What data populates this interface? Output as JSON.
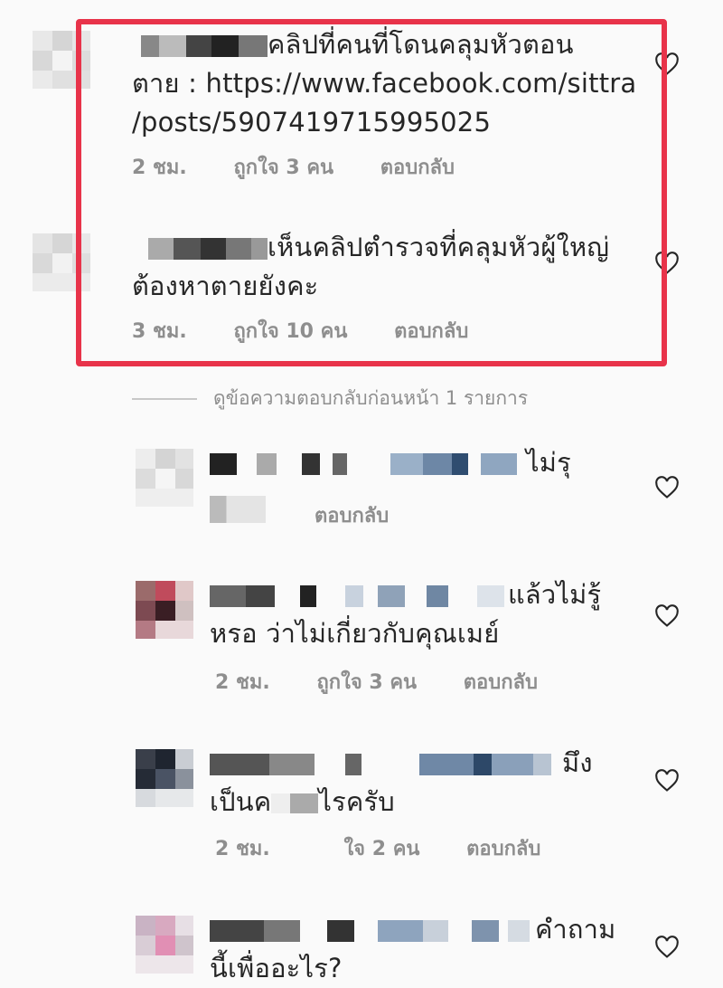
{
  "comments": [
    {
      "text_line1": "คลิปที่คนที่โดนคลุมหัวตอน",
      "text_line2": "ตาย : https://www.facebook.com/sittra",
      "text_line3": "/posts/5907419715995025",
      "time": "2 ชม.",
      "likes": "ถูกใจ 3 คน",
      "reply": "ตอบกลับ"
    },
    {
      "text_line1": "เห็นคลิปตำรวจที่คลุมหัวผู้ใหญ่",
      "text_line2": "ต้องหาตายยังคะ",
      "time": "3 ชม.",
      "likes": "ถูกใจ 10 คน",
      "reply": "ตอบกลับ"
    }
  ],
  "view_previous": "ดูข้อความตอบกลับก่อนหน้า 1 รายการ",
  "replies": [
    {
      "text_line1": "ไม่รุ",
      "reply": "ตอบกลับ"
    },
    {
      "text_line1": "แล้วไม่รู้",
      "text_line2": "หรอ ว่าไม่เกี่ยวกับคุณเมย์",
      "time": "2 ชม.",
      "likes": "ถูกใจ 3 คน",
      "reply": "ตอบกลับ"
    },
    {
      "text_line1": "มึง",
      "text_line2a": "เป็นค",
      "text_line2b": "ไรครับ",
      "time": "2 ชม.",
      "likes": "ใจ 2 คน",
      "reply": "ตอบกลับ"
    },
    {
      "text_line1": "คำถาม",
      "text_line2": "นี้เพื่ออะไร?"
    }
  ],
  "colors": {
    "highlight": "#e8334a",
    "meta": "#8e8e8e",
    "text": "#262626"
  }
}
